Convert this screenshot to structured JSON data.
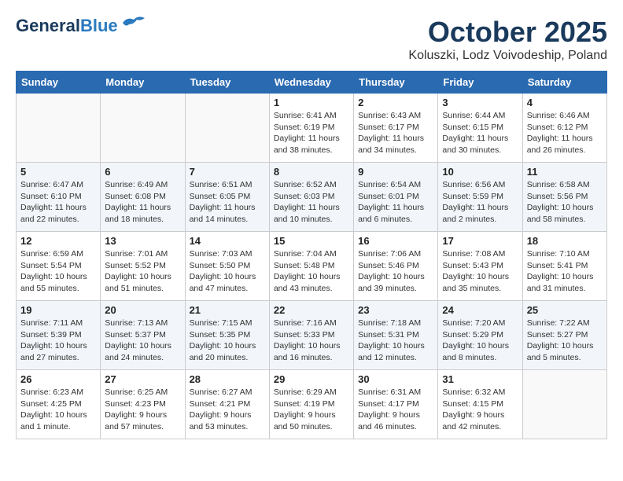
{
  "header": {
    "logo_general": "General",
    "logo_blue": "Blue",
    "month_title": "October 2025",
    "subtitle": "Koluszki, Lodz Voivodeship, Poland"
  },
  "days_of_week": [
    "Sunday",
    "Monday",
    "Tuesday",
    "Wednesday",
    "Thursday",
    "Friday",
    "Saturday"
  ],
  "weeks": [
    [
      {
        "day": "",
        "info": ""
      },
      {
        "day": "",
        "info": ""
      },
      {
        "day": "",
        "info": ""
      },
      {
        "day": "1",
        "info": "Sunrise: 6:41 AM\nSunset: 6:19 PM\nDaylight: 11 hours\nand 38 minutes."
      },
      {
        "day": "2",
        "info": "Sunrise: 6:43 AM\nSunset: 6:17 PM\nDaylight: 11 hours\nand 34 minutes."
      },
      {
        "day": "3",
        "info": "Sunrise: 6:44 AM\nSunset: 6:15 PM\nDaylight: 11 hours\nand 30 minutes."
      },
      {
        "day": "4",
        "info": "Sunrise: 6:46 AM\nSunset: 6:12 PM\nDaylight: 11 hours\nand 26 minutes."
      }
    ],
    [
      {
        "day": "5",
        "info": "Sunrise: 6:47 AM\nSunset: 6:10 PM\nDaylight: 11 hours\nand 22 minutes."
      },
      {
        "day": "6",
        "info": "Sunrise: 6:49 AM\nSunset: 6:08 PM\nDaylight: 11 hours\nand 18 minutes."
      },
      {
        "day": "7",
        "info": "Sunrise: 6:51 AM\nSunset: 6:05 PM\nDaylight: 11 hours\nand 14 minutes."
      },
      {
        "day": "8",
        "info": "Sunrise: 6:52 AM\nSunset: 6:03 PM\nDaylight: 11 hours\nand 10 minutes."
      },
      {
        "day": "9",
        "info": "Sunrise: 6:54 AM\nSunset: 6:01 PM\nDaylight: 11 hours\nand 6 minutes."
      },
      {
        "day": "10",
        "info": "Sunrise: 6:56 AM\nSunset: 5:59 PM\nDaylight: 11 hours\nand 2 minutes."
      },
      {
        "day": "11",
        "info": "Sunrise: 6:58 AM\nSunset: 5:56 PM\nDaylight: 10 hours\nand 58 minutes."
      }
    ],
    [
      {
        "day": "12",
        "info": "Sunrise: 6:59 AM\nSunset: 5:54 PM\nDaylight: 10 hours\nand 55 minutes."
      },
      {
        "day": "13",
        "info": "Sunrise: 7:01 AM\nSunset: 5:52 PM\nDaylight: 10 hours\nand 51 minutes."
      },
      {
        "day": "14",
        "info": "Sunrise: 7:03 AM\nSunset: 5:50 PM\nDaylight: 10 hours\nand 47 minutes."
      },
      {
        "day": "15",
        "info": "Sunrise: 7:04 AM\nSunset: 5:48 PM\nDaylight: 10 hours\nand 43 minutes."
      },
      {
        "day": "16",
        "info": "Sunrise: 7:06 AM\nSunset: 5:46 PM\nDaylight: 10 hours\nand 39 minutes."
      },
      {
        "day": "17",
        "info": "Sunrise: 7:08 AM\nSunset: 5:43 PM\nDaylight: 10 hours\nand 35 minutes."
      },
      {
        "day": "18",
        "info": "Sunrise: 7:10 AM\nSunset: 5:41 PM\nDaylight: 10 hours\nand 31 minutes."
      }
    ],
    [
      {
        "day": "19",
        "info": "Sunrise: 7:11 AM\nSunset: 5:39 PM\nDaylight: 10 hours\nand 27 minutes."
      },
      {
        "day": "20",
        "info": "Sunrise: 7:13 AM\nSunset: 5:37 PM\nDaylight: 10 hours\nand 24 minutes."
      },
      {
        "day": "21",
        "info": "Sunrise: 7:15 AM\nSunset: 5:35 PM\nDaylight: 10 hours\nand 20 minutes."
      },
      {
        "day": "22",
        "info": "Sunrise: 7:16 AM\nSunset: 5:33 PM\nDaylight: 10 hours\nand 16 minutes."
      },
      {
        "day": "23",
        "info": "Sunrise: 7:18 AM\nSunset: 5:31 PM\nDaylight: 10 hours\nand 12 minutes."
      },
      {
        "day": "24",
        "info": "Sunrise: 7:20 AM\nSunset: 5:29 PM\nDaylight: 10 hours\nand 8 minutes."
      },
      {
        "day": "25",
        "info": "Sunrise: 7:22 AM\nSunset: 5:27 PM\nDaylight: 10 hours\nand 5 minutes."
      }
    ],
    [
      {
        "day": "26",
        "info": "Sunrise: 6:23 AM\nSunset: 4:25 PM\nDaylight: 10 hours\nand 1 minute."
      },
      {
        "day": "27",
        "info": "Sunrise: 6:25 AM\nSunset: 4:23 PM\nDaylight: 9 hours\nand 57 minutes."
      },
      {
        "day": "28",
        "info": "Sunrise: 6:27 AM\nSunset: 4:21 PM\nDaylight: 9 hours\nand 53 minutes."
      },
      {
        "day": "29",
        "info": "Sunrise: 6:29 AM\nSunset: 4:19 PM\nDaylight: 9 hours\nand 50 minutes."
      },
      {
        "day": "30",
        "info": "Sunrise: 6:31 AM\nSunset: 4:17 PM\nDaylight: 9 hours\nand 46 minutes."
      },
      {
        "day": "31",
        "info": "Sunrise: 6:32 AM\nSunset: 4:15 PM\nDaylight: 9 hours\nand 42 minutes."
      },
      {
        "day": "",
        "info": ""
      }
    ]
  ]
}
